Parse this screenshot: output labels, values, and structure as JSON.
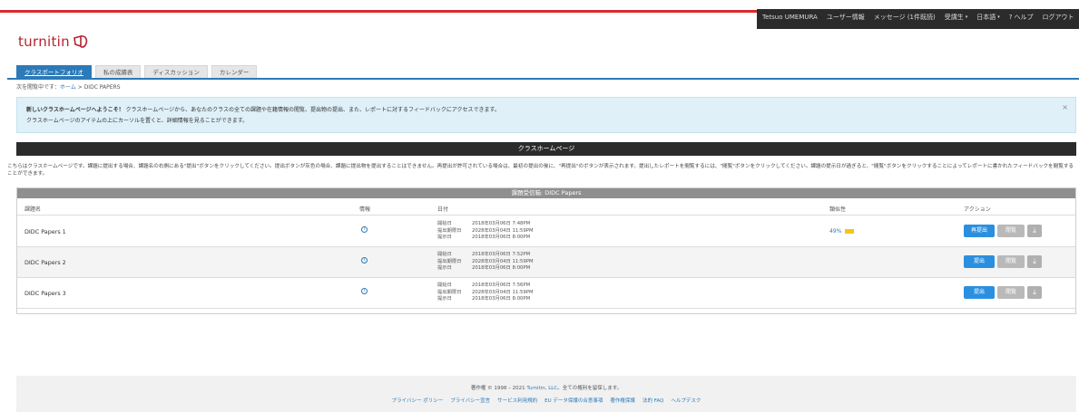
{
  "topnav": {
    "user": "Tetsuo UMEMURA",
    "user_info": "ユーザー情報",
    "messages": "メッセージ (1件既読)",
    "role": "受講生",
    "language": "日本語",
    "help": "ヘルプ",
    "logout": "ログアウト"
  },
  "logo": {
    "text": "turnitin"
  },
  "tabs": [
    "クラスポートフォリオ",
    "私の成績表",
    "ディスカッション",
    "カレンダー"
  ],
  "breadcrumb": {
    "prefix": "次を閲覧中です：",
    "home": "ホーム",
    "separator": " > ",
    "current": "DIDC PAPERS"
  },
  "infobox": {
    "line1_bold": "新しいクラスホームページへようこそ！",
    "line1": "クラスホームページから、あなたのクラスの全ての課題や在籍情報の閲覧、提出物の提出、また、レポートに対するフィードバックにアクセスできます。",
    "line2": "クラスホームページのアイテムの上にカーソルを置くと、詳細情報を見ることができます。",
    "close": "×"
  },
  "section_title": "クラスホームページ",
  "description": "こちらはクラスホームページです。課題に提出する場合、課題名の右側にある\"提出\"ボタンをクリックしてください。提出ボタンが灰色の場合、課題に提出物を提出することはできません。再提出が許可されている場合は、最初の提出の後に、\"再提出\"のボタンが表示されます。提出したレポートを閲覧するには、\"閲覧\"ボタンをクリックしてください。課題の提示日が過ぎると、\"閲覧\"ボタンをクリックすることによってレポートに書かれたフィードバックを閲覧することができます。",
  "table": {
    "title": "課題受信箱: DIDC Papers",
    "headers": {
      "name": "課題名",
      "info": "情報",
      "dates": "日付",
      "similarity": "類似性",
      "actions": "アクション"
    },
    "rows": [
      {
        "name": "DIDC Papers 1",
        "info_icon": "info-icon",
        "start_label": "開始日",
        "start": "2018年03月06日 7:48PM",
        "due_label": "提出期限日",
        "due": "2028年03月04日 11:59PM",
        "post_label": "提示日",
        "post": "2018年03月06日 8:00PM",
        "similarity": "49%",
        "similarity_color": "#f5c518",
        "primary_button": "再提出",
        "view_button": "閲覧",
        "download_icon": "download-icon"
      },
      {
        "name": "DIDC Papers 2",
        "info_icon": "info-icon",
        "start_label": "開始日",
        "start": "2018年03月06日 7:52PM",
        "due_label": "提出期限日",
        "due": "2028年03月04日 11:59PM",
        "post_label": "提示日",
        "post": "2018年03月06日 8:00PM",
        "similarity": "",
        "primary_button": "提出",
        "view_button": "閲覧",
        "download_icon": "download-icon"
      },
      {
        "name": "DIDC Papers 3",
        "info_icon": "info-icon",
        "start_label": "開始日",
        "start": "2018年03月06日 7:56PM",
        "due_label": "提出期限日",
        "due": "2028年03月04日 11:59PM",
        "post_label": "提示日",
        "post": "2018年03月06日 8:00PM",
        "similarity": "",
        "primary_button": "提出",
        "view_button": "閲覧",
        "download_icon": "download-icon"
      }
    ]
  },
  "footer": {
    "copyright_prefix": "著作権 © 1998 – 2021",
    "copyright_link": "Turnitin, LLC",
    "copyright_suffix": "。全ての権利を留保します。",
    "links": [
      "プライバシー ポリシー",
      "プライバシー宣言",
      "サービス利用規約",
      "EU データ保護の合意事項",
      "著作権保護",
      "法的 FAQ",
      "ヘルプデスク"
    ]
  },
  "colors": {
    "brand": "#b6212d",
    "accent": "#2b7ab9",
    "button_blue": "#2b8fe0",
    "top_red": "#d92b2b"
  }
}
